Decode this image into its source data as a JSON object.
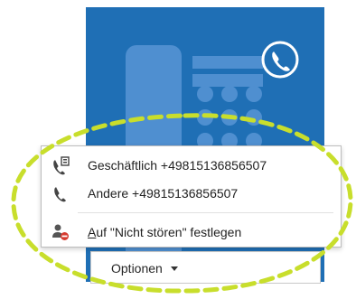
{
  "colors": {
    "tile_blue": "#1f6fb5",
    "tile_light_blue": "#4f8fd0",
    "highlight_dash": "#c8de2c",
    "dnd_red": "#d63a2f",
    "icon_gray": "#444444"
  },
  "tile": {
    "icon": "phone-circle-icon"
  },
  "menu": {
    "items": [
      {
        "icon": "work-phone-icon",
        "label": "Geschäftlich +49815136856507"
      },
      {
        "icon": "phone-icon",
        "label": "Andere +49815136856507"
      },
      {
        "icon": "do-not-disturb-icon",
        "label_underlined": "A",
        "label_rest": "uf \"Nicht stören\" festlegen"
      }
    ]
  },
  "options_bar": {
    "label": "Optionen",
    "icon": "caret-down-icon"
  }
}
